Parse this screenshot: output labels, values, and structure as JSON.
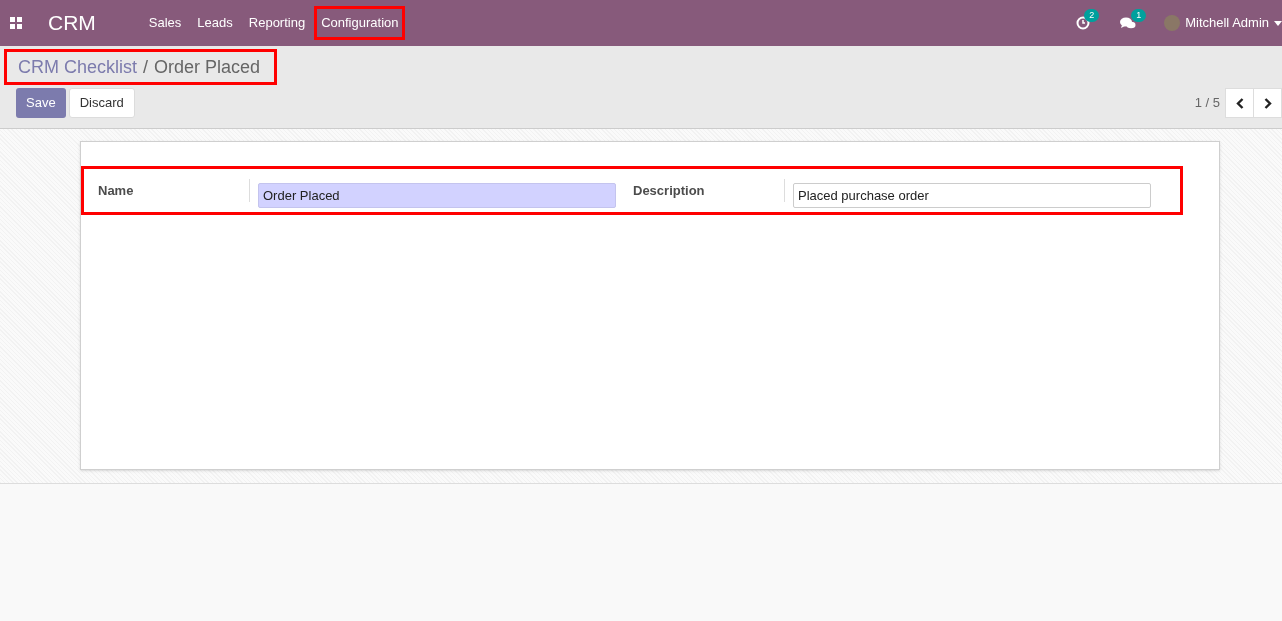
{
  "navbar": {
    "app_name": "CRM",
    "menu": [
      {
        "label": "Sales",
        "highlighted": false
      },
      {
        "label": "Leads",
        "highlighted": false
      },
      {
        "label": "Reporting",
        "highlighted": false
      },
      {
        "label": "Configuration",
        "highlighted": true
      }
    ],
    "activity_count": "2",
    "message_count": "1",
    "user": "Mitchell Admin"
  },
  "breadcrumb": {
    "highlighted": true,
    "items": [
      "CRM Checklist",
      "Order Placed"
    ],
    "separator": "/"
  },
  "buttons": [
    "Save",
    "Discard"
  ],
  "pager": {
    "text": "1 / 5"
  },
  "form": {
    "highlighted": true,
    "fields": [
      {
        "label": "Name",
        "value": "Order Placed",
        "required": true
      },
      {
        "label": "Description",
        "value": "Placed purchase order",
        "required": false
      }
    ]
  }
}
